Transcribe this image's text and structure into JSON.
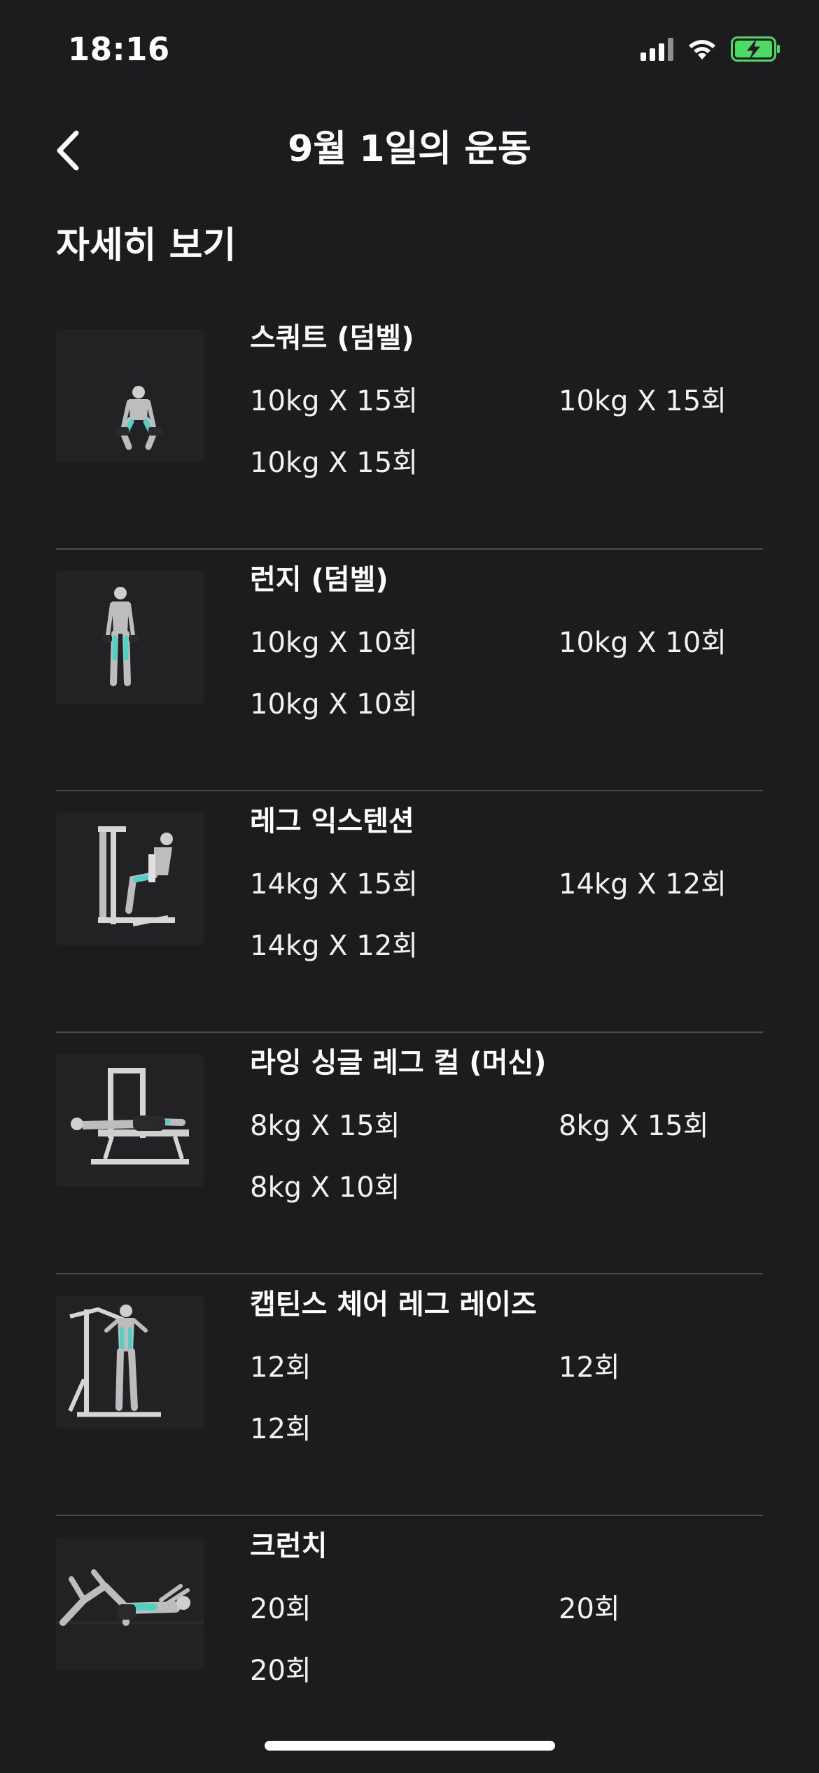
{
  "status_bar": {
    "time": "18:16"
  },
  "nav": {
    "title": "9월 1일의 운동"
  },
  "section": {
    "title": "자세히 보기"
  },
  "exercises": [
    {
      "name": "스쿼트 (덤벨)",
      "icon": "squat-illustration",
      "sets": [
        "10kg X 15회",
        "10kg X 15회",
        "10kg X 15회"
      ]
    },
    {
      "name": "런지 (덤벨)",
      "icon": "lunge-illustration",
      "sets": [
        "10kg X 10회",
        "10kg X 10회",
        "10kg X 10회"
      ]
    },
    {
      "name": "레그 익스텐션",
      "icon": "leg-extension-illustration",
      "sets": [
        "14kg X 15회",
        "14kg X 12회",
        "14kg X 12회"
      ]
    },
    {
      "name": "라잉 싱글 레그 컬 (머신)",
      "icon": "lying-leg-curl-illustration",
      "sets": [
        "8kg X 15회",
        "8kg X 15회",
        "8kg X 10회"
      ]
    },
    {
      "name": "캡틴스 체어 레그 레이즈",
      "icon": "captains-chair-illustration",
      "sets": [
        "12회",
        "12회",
        "12회"
      ]
    },
    {
      "name": "크런치",
      "icon": "crunch-illustration",
      "sets": [
        "20회",
        "20회",
        "20회"
      ]
    }
  ],
  "colors": {
    "background": "#1c1c1e",
    "divider": "#4a4a4e",
    "battery_fill": "#4cd964",
    "muscle_highlight": "#4fd1c5"
  }
}
